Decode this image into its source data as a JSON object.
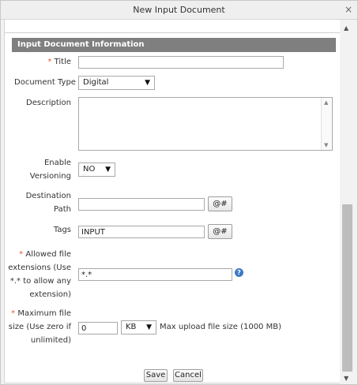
{
  "dialog": {
    "title": "New Input Document",
    "close_glyph": "×"
  },
  "section": {
    "title": "Input Document Information"
  },
  "form": {
    "title": {
      "required": "*",
      "label": "Title",
      "value": ""
    },
    "document_type": {
      "label": "Document Type",
      "value": "Digital"
    },
    "description": {
      "label": "Description",
      "value": ""
    },
    "versioning": {
      "label_line1": "Enable",
      "label_line2": "Versioning",
      "value": "NO"
    },
    "destination_path": {
      "label_line1": "Destination",
      "label_line2": "Path",
      "value": "",
      "button": "@#"
    },
    "tags": {
      "label": "Tags",
      "value": "INPUT",
      "button": "@#"
    },
    "allowed_ext": {
      "required": "*",
      "label_line1": "Allowed file",
      "label_line2": "extensions (Use",
      "label_line3": "*.* to allow any",
      "label_line4": "extension)",
      "value": "*.*",
      "help_glyph": "?"
    },
    "max_size": {
      "required": "*",
      "label_line1": "Maximum file",
      "label_line2": "size (Use zero if",
      "label_line3": "unlimited)",
      "value": "0",
      "unit": "KB",
      "note": "Max upload file size (1000 MB)"
    }
  },
  "buttons": {
    "save": "Save",
    "cancel": "Cancel"
  }
}
